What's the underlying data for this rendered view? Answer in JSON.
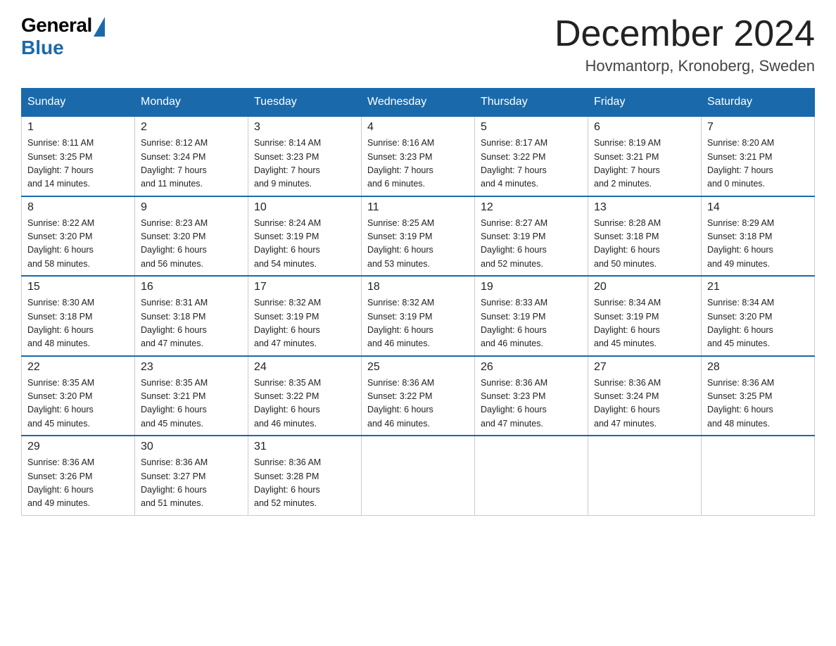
{
  "header": {
    "logo_general": "General",
    "logo_blue": "Blue",
    "month_year": "December 2024",
    "location": "Hovmantorp, Kronoberg, Sweden"
  },
  "days_of_week": [
    "Sunday",
    "Monday",
    "Tuesday",
    "Wednesday",
    "Thursday",
    "Friday",
    "Saturday"
  ],
  "weeks": [
    [
      {
        "day": 1,
        "sunrise": "8:11 AM",
        "sunset": "3:25 PM",
        "daylight": "7 hours and 14 minutes."
      },
      {
        "day": 2,
        "sunrise": "8:12 AM",
        "sunset": "3:24 PM",
        "daylight": "7 hours and 11 minutes."
      },
      {
        "day": 3,
        "sunrise": "8:14 AM",
        "sunset": "3:23 PM",
        "daylight": "7 hours and 9 minutes."
      },
      {
        "day": 4,
        "sunrise": "8:16 AM",
        "sunset": "3:23 PM",
        "daylight": "7 hours and 6 minutes."
      },
      {
        "day": 5,
        "sunrise": "8:17 AM",
        "sunset": "3:22 PM",
        "daylight": "7 hours and 4 minutes."
      },
      {
        "day": 6,
        "sunrise": "8:19 AM",
        "sunset": "3:21 PM",
        "daylight": "7 hours and 2 minutes."
      },
      {
        "day": 7,
        "sunrise": "8:20 AM",
        "sunset": "3:21 PM",
        "daylight": "7 hours and 0 minutes."
      }
    ],
    [
      {
        "day": 8,
        "sunrise": "8:22 AM",
        "sunset": "3:20 PM",
        "daylight": "6 hours and 58 minutes."
      },
      {
        "day": 9,
        "sunrise": "8:23 AM",
        "sunset": "3:20 PM",
        "daylight": "6 hours and 56 minutes."
      },
      {
        "day": 10,
        "sunrise": "8:24 AM",
        "sunset": "3:19 PM",
        "daylight": "6 hours and 54 minutes."
      },
      {
        "day": 11,
        "sunrise": "8:25 AM",
        "sunset": "3:19 PM",
        "daylight": "6 hours and 53 minutes."
      },
      {
        "day": 12,
        "sunrise": "8:27 AM",
        "sunset": "3:19 PM",
        "daylight": "6 hours and 52 minutes."
      },
      {
        "day": 13,
        "sunrise": "8:28 AM",
        "sunset": "3:18 PM",
        "daylight": "6 hours and 50 minutes."
      },
      {
        "day": 14,
        "sunrise": "8:29 AM",
        "sunset": "3:18 PM",
        "daylight": "6 hours and 49 minutes."
      }
    ],
    [
      {
        "day": 15,
        "sunrise": "8:30 AM",
        "sunset": "3:18 PM",
        "daylight": "6 hours and 48 minutes."
      },
      {
        "day": 16,
        "sunrise": "8:31 AM",
        "sunset": "3:18 PM",
        "daylight": "6 hours and 47 minutes."
      },
      {
        "day": 17,
        "sunrise": "8:32 AM",
        "sunset": "3:19 PM",
        "daylight": "6 hours and 47 minutes."
      },
      {
        "day": 18,
        "sunrise": "8:32 AM",
        "sunset": "3:19 PM",
        "daylight": "6 hours and 46 minutes."
      },
      {
        "day": 19,
        "sunrise": "8:33 AM",
        "sunset": "3:19 PM",
        "daylight": "6 hours and 46 minutes."
      },
      {
        "day": 20,
        "sunrise": "8:34 AM",
        "sunset": "3:19 PM",
        "daylight": "6 hours and 45 minutes."
      },
      {
        "day": 21,
        "sunrise": "8:34 AM",
        "sunset": "3:20 PM",
        "daylight": "6 hours and 45 minutes."
      }
    ],
    [
      {
        "day": 22,
        "sunrise": "8:35 AM",
        "sunset": "3:20 PM",
        "daylight": "6 hours and 45 minutes."
      },
      {
        "day": 23,
        "sunrise": "8:35 AM",
        "sunset": "3:21 PM",
        "daylight": "6 hours and 45 minutes."
      },
      {
        "day": 24,
        "sunrise": "8:35 AM",
        "sunset": "3:22 PM",
        "daylight": "6 hours and 46 minutes."
      },
      {
        "day": 25,
        "sunrise": "8:36 AM",
        "sunset": "3:22 PM",
        "daylight": "6 hours and 46 minutes."
      },
      {
        "day": 26,
        "sunrise": "8:36 AM",
        "sunset": "3:23 PM",
        "daylight": "6 hours and 47 minutes."
      },
      {
        "day": 27,
        "sunrise": "8:36 AM",
        "sunset": "3:24 PM",
        "daylight": "6 hours and 47 minutes."
      },
      {
        "day": 28,
        "sunrise": "8:36 AM",
        "sunset": "3:25 PM",
        "daylight": "6 hours and 48 minutes."
      }
    ],
    [
      {
        "day": 29,
        "sunrise": "8:36 AM",
        "sunset": "3:26 PM",
        "daylight": "6 hours and 49 minutes."
      },
      {
        "day": 30,
        "sunrise": "8:36 AM",
        "sunset": "3:27 PM",
        "daylight": "6 hours and 51 minutes."
      },
      {
        "day": 31,
        "sunrise": "8:36 AM",
        "sunset": "3:28 PM",
        "daylight": "6 hours and 52 minutes."
      },
      null,
      null,
      null,
      null
    ]
  ]
}
